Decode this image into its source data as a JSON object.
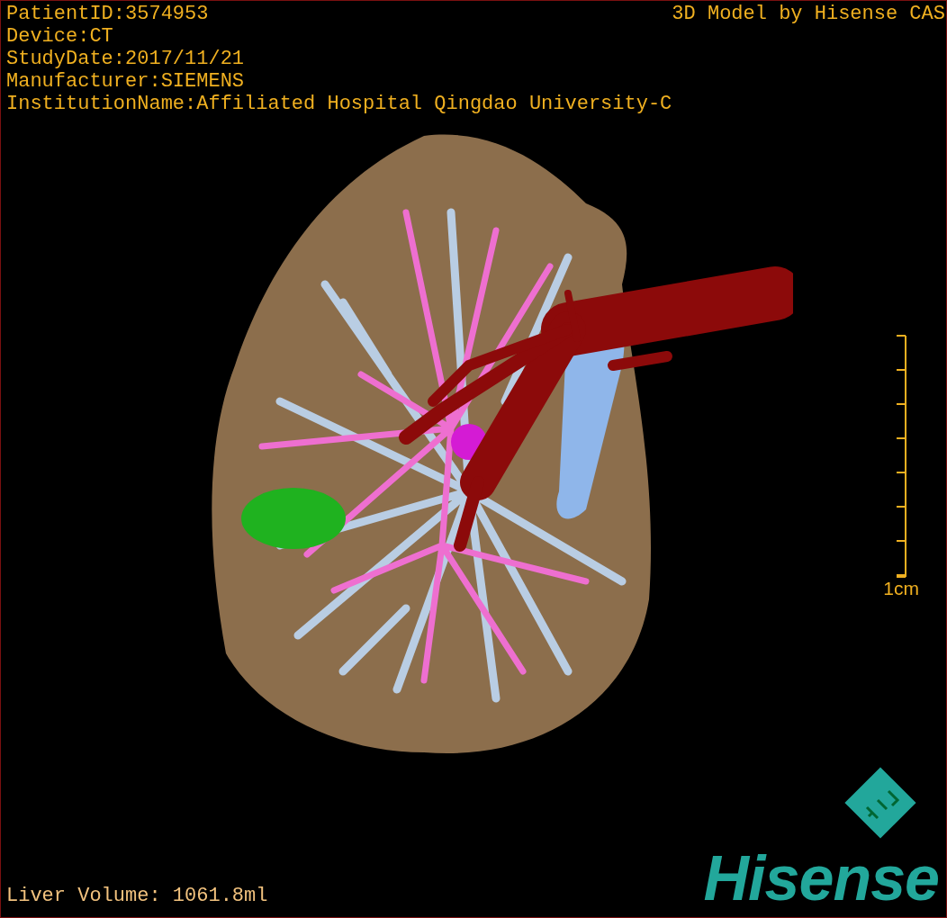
{
  "viewport": {
    "patient_info": [
      "PatientID:3574953",
      "Device:CT",
      "StudyDate:2017/11/21",
      "Manufacturer:SIEMENS",
      "InstitutionName:Affiliated Hospital Qingdao University-C"
    ],
    "caption": "3D Model by Hisense CAS",
    "scale_bar": {
      "label": "1cm"
    },
    "volume": "Liver Volume: 1061.8ml",
    "logo": {
      "wordmark": "Hisense"
    }
  }
}
